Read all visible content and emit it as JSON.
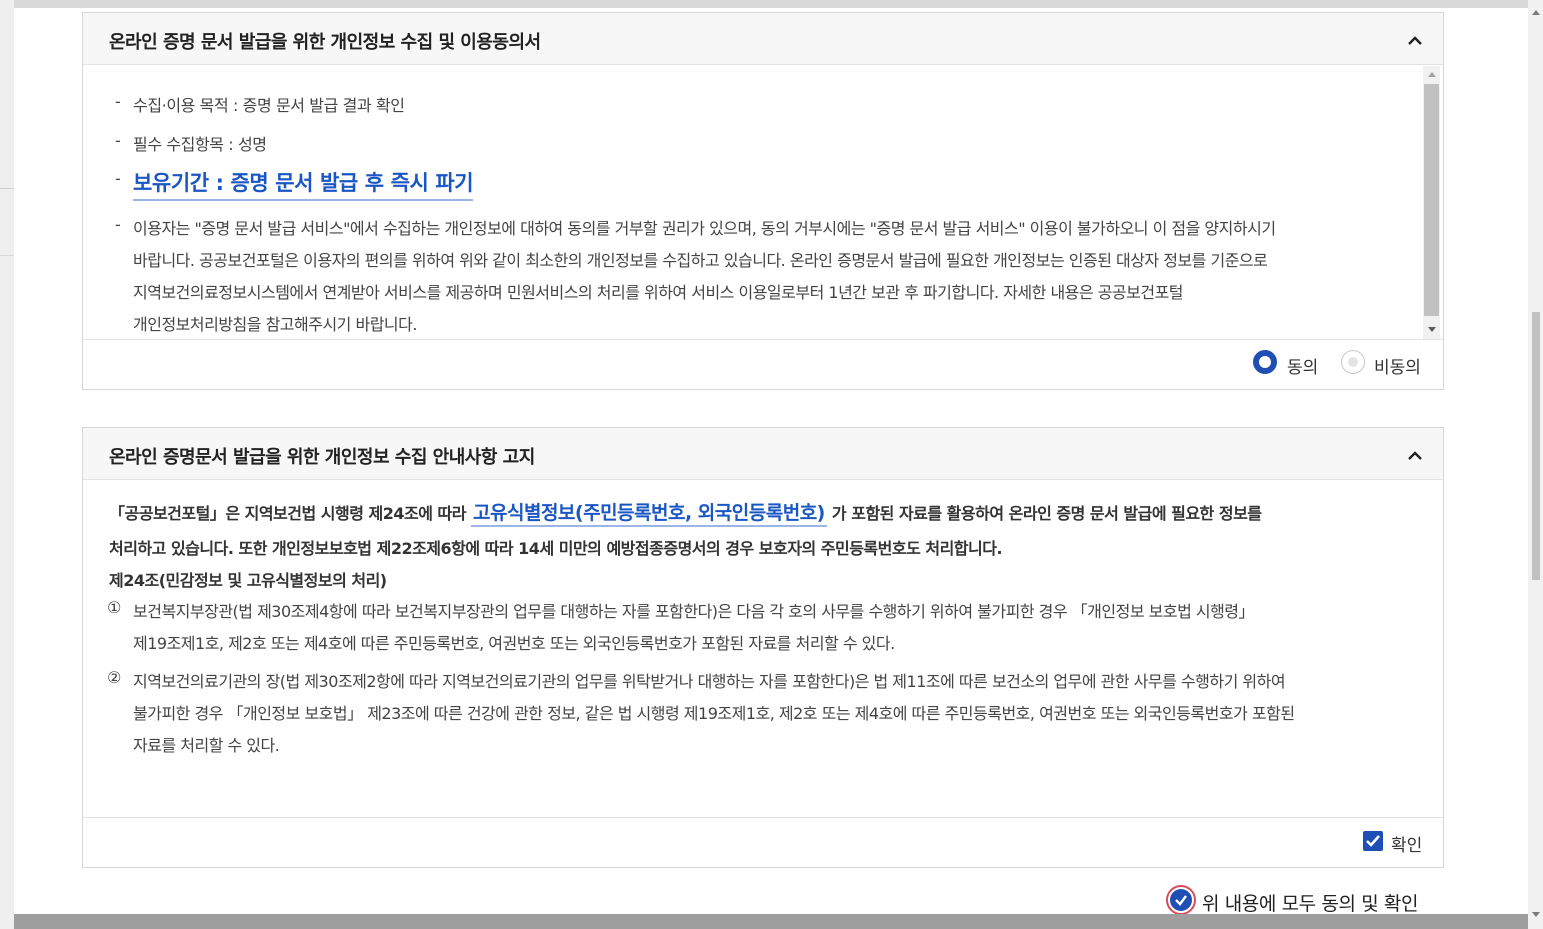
{
  "panel1": {
    "title": "온라인 증명 문서 발급을 위한 개인정보 수집 및 이용동의서",
    "items": [
      "수집·이용 목적 : 증명 문서 발급 결과 확인",
      "필수 수집항목 : 성명",
      "보유기간 : 증명 문서 발급 후 즉시 파기"
    ],
    "paragraph": [
      "이용자는 \"증명 문서 발급 서비스\"에서 수집하는 개인정보에 대하여 동의를 거부할 권리가 있으며, 동의 거부시에는 \"증명 문서 발급 서비스\" 이용이 불가하오니 이 점을 양지하시기",
      "바랍니다. 공공보건포털은 이용자의 편의를 위하여 위와 같이 최소한의 개인정보를 수집하고 있습니다. 온라인 증명문서 발급에 필요한 개인정보는 인증된 대상자 정보를 기준으로",
      "지역보건의료정보시스템에서 연계받아 서비스를 제공하며 민원서비스의 처리를 위하여 서비스 이용일로부터 1년간 보관 후 파기합니다. 자세한 내용은 공공보건포털",
      "개인정보처리방침을 참고해주시기 바랍니다."
    ],
    "agree_label": "동의",
    "disagree_label": "비동의",
    "selected": "동의"
  },
  "panel2": {
    "title": "온라인 증명문서 발급을 위한 개인정보 수집 안내사항 고지",
    "line1_pre": "「공공보건포털」은 지역보건법 시행령 제24조에 따라 ",
    "line1_hl": "고유식별정보(주민등록번호, 외국인등록번호)",
    "line1_post": " 가 포함된 자료를 활용하여 온라인 증명 문서 발급에 필요한 정보를",
    "line2": "처리하고 있습니다. 또한 개인정보보호법 제22조제6항에 따라 14세 미만의 예방접종증명서의 경우 보호자의 주민등록번호도 처리합니다.",
    "line3": "제24조(민감정보 및 고유식별정보의 처리)",
    "item1_num": "①",
    "item1_lines": [
      "보건복지부장관(법 제30조제4항에 따라 보건복지부장관의 업무를 대행하는 자를 포함한다)은 다음 각 호의 사무를 수행하기 위하여 불가피한 경우 「개인정보 보호법 시행령」",
      "제19조제1호, 제2호 또는 제4호에 따른 주민등록번호, 여권번호 또는 외국인등록번호가 포함된 자료를 처리할 수 있다."
    ],
    "item2_num": "②",
    "item2_lines": [
      "지역보건의료기관의 장(법 제30조제2항에 따라 지역보건의료기관의 업무를 위탁받거나 대행하는 자를 포함한다)은 법 제11조에 따른 보건소의 업무에 관한 사무를 수행하기 위하여",
      "불가피한 경우 「개인정보 보호법」 제23조에 따른 건강에 관한 정보, 같은 법 시행령 제19조제1호, 제2호 또는 제4호에 따른 주민등록번호, 여권번호 또는 외국인등록번호가 포함된",
      "자료를 처리할 수 있다."
    ],
    "confirm_label": "확인",
    "confirm_checked": true
  },
  "all_agree_label": "위 내용에 모두 동의 및 확인",
  "colors": {
    "accent": "#1a56c4",
    "checkbox": "#1f4fb5",
    "all_agree_ring": "#d94a5a"
  }
}
